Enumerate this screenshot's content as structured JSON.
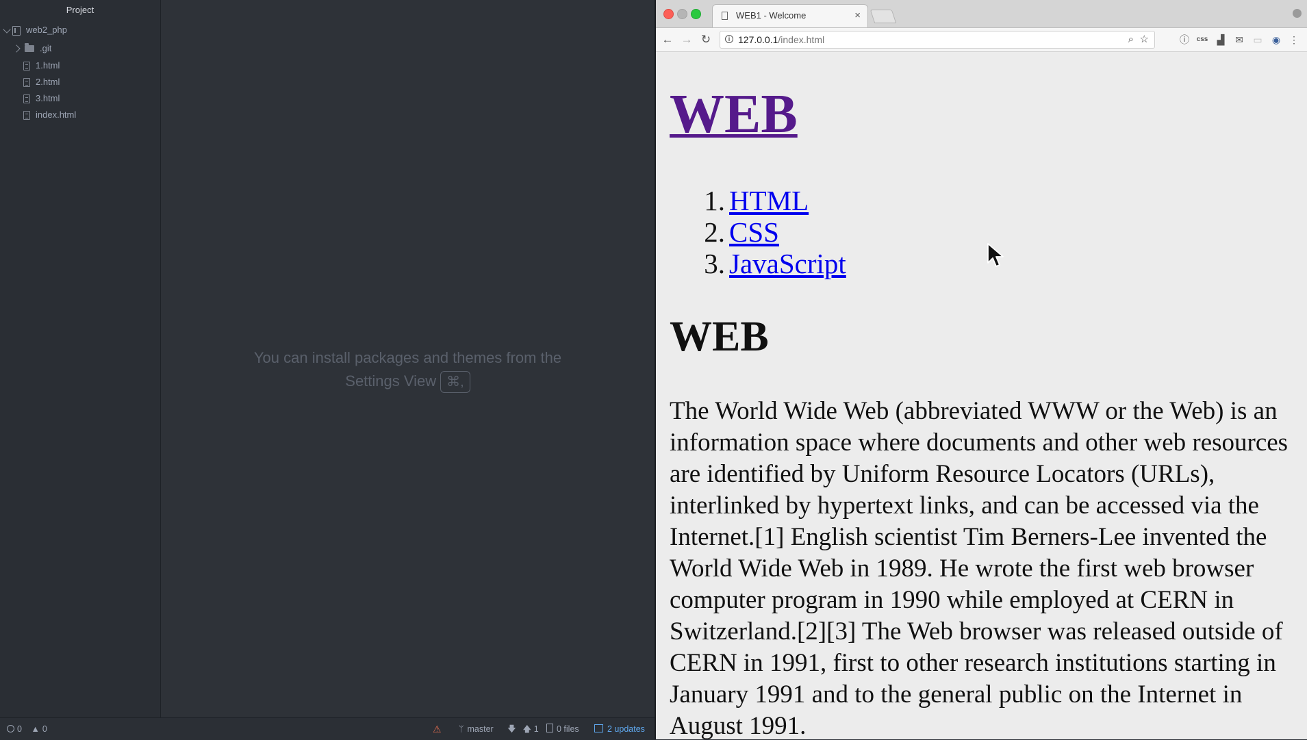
{
  "atom": {
    "tree": {
      "header": "Project",
      "root": "web2_php",
      "items": [
        {
          "label": ".git",
          "kind": "folder"
        },
        {
          "label": "1.html",
          "kind": "file"
        },
        {
          "label": "2.html",
          "kind": "file"
        },
        {
          "label": "3.html",
          "kind": "file"
        },
        {
          "label": "index.html",
          "kind": "file"
        }
      ]
    },
    "hint": {
      "line1": "You can install packages and themes from the",
      "line2": "Settings View",
      "shortcut": "⌘,"
    },
    "status": {
      "errors": "0",
      "warnings": "0",
      "branch": "master",
      "ahead": "1",
      "files": "0 files",
      "updates": "2 updates"
    }
  },
  "browser": {
    "tab_title": "WEB1 - Welcome",
    "tab_close": "×",
    "url_host": "127.0.0.1",
    "url_path": "/index.html",
    "page": {
      "title_link": "WEB",
      "list": [
        {
          "num": "1.",
          "label": "HTML"
        },
        {
          "num": "2.",
          "label": "CSS"
        },
        {
          "num": "3.",
          "label": "JavaScript"
        }
      ],
      "heading": "WEB",
      "paragraph": "The World Wide Web (abbreviated WWW or the Web) is an information space where documents and other web resources are identified by Uniform Resource Locators (URLs), interlinked by hypertext links, and can be accessed via the Internet.[1] English scientist Tim Berners-Lee invented the World Wide Web in 1989. He wrote the first web browser computer program in 1990 while employed at CERN in Switzerland.[2][3] The Web browser was released outside of CERN in 1991, first to other research institutions starting in January 1991 and to the general public on the Internet in August 1991."
    }
  },
  "colors": {
    "editor_bg": "#2e3238",
    "visited_link": "#551a8b",
    "link": "#0000ee",
    "status_blue": "#5fa8ee"
  }
}
